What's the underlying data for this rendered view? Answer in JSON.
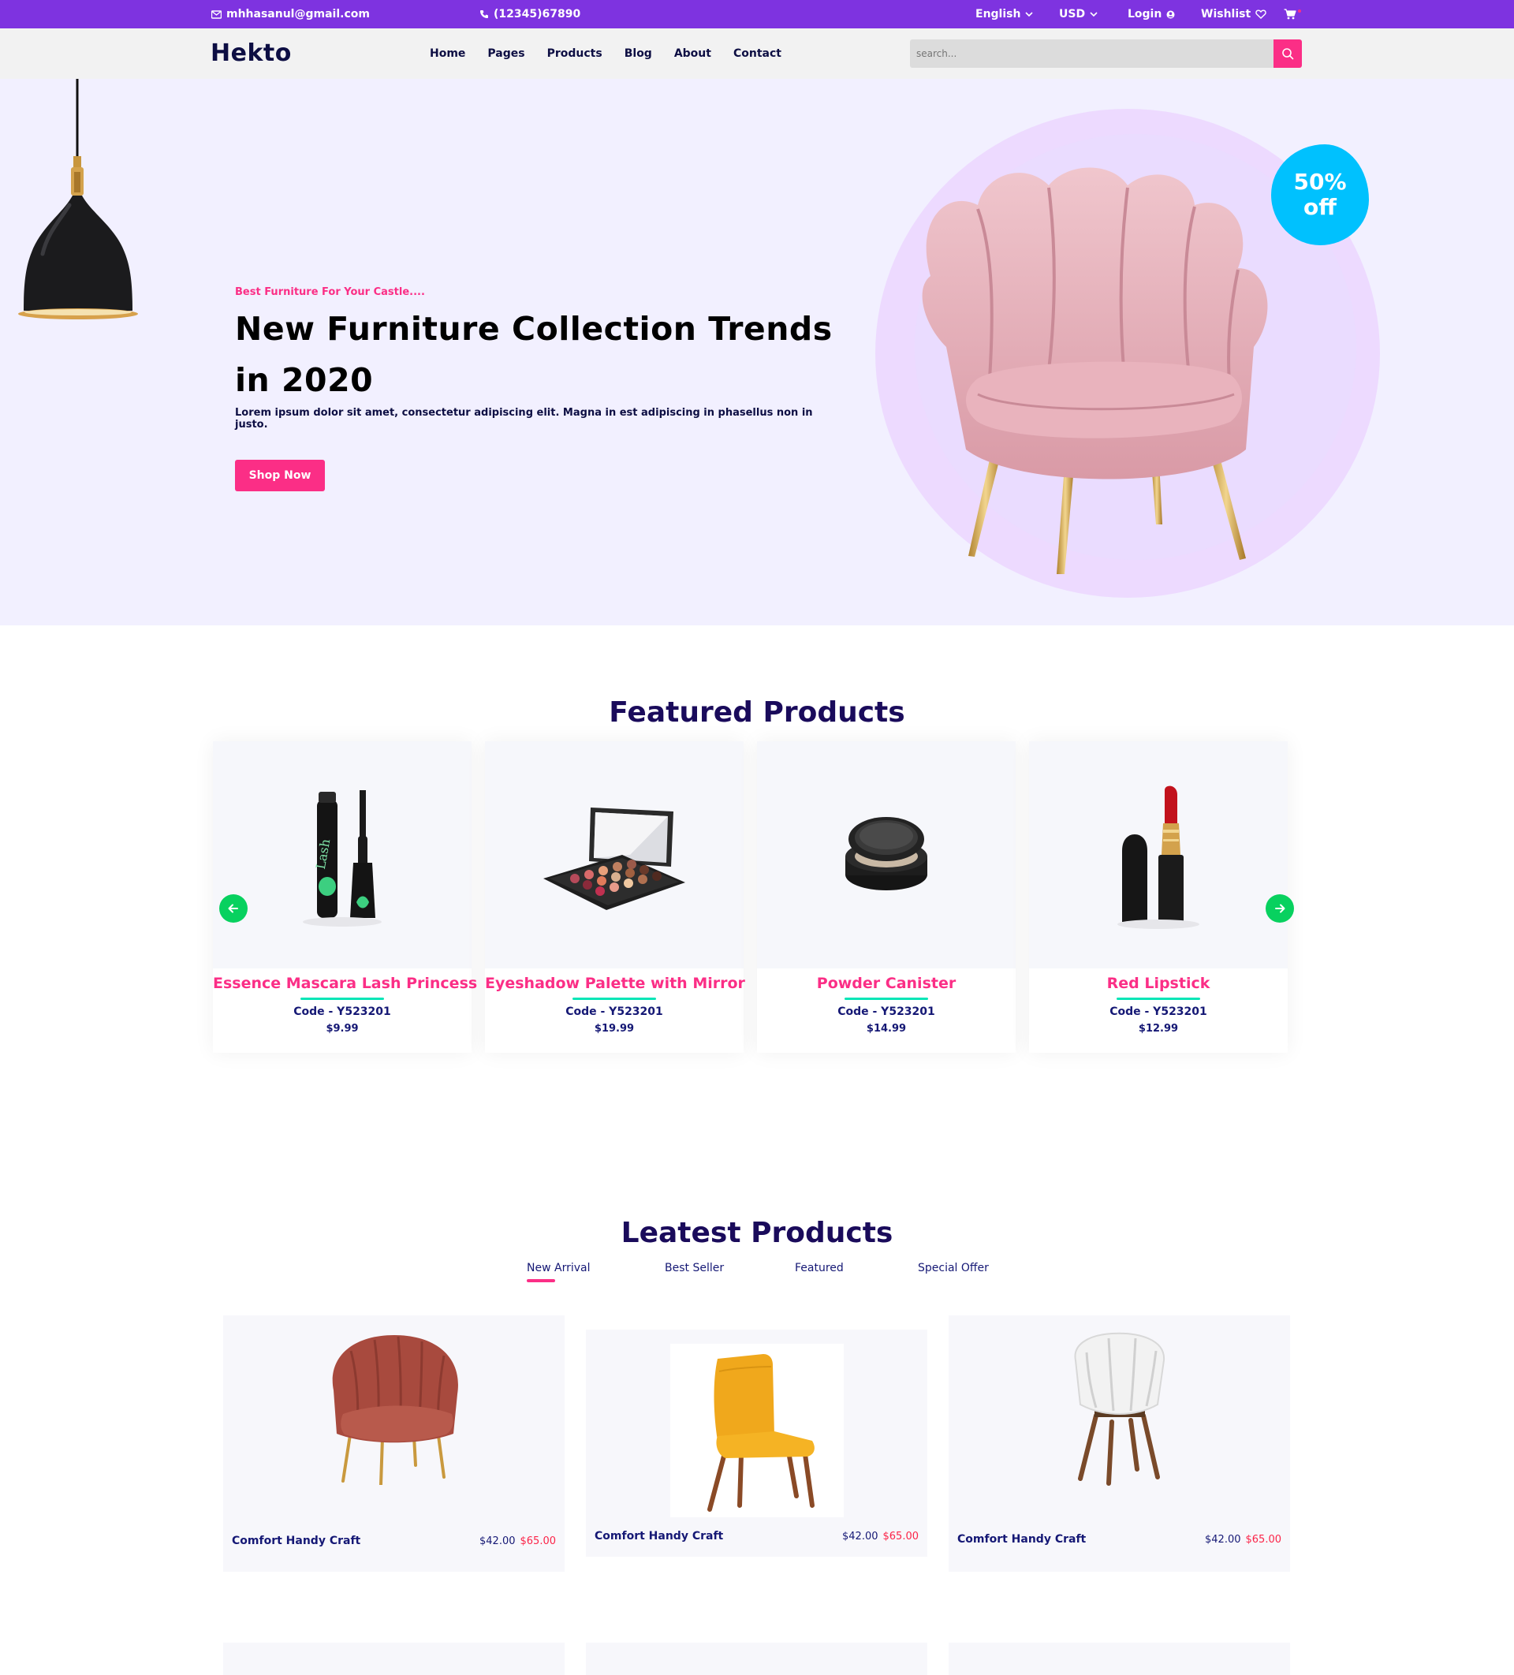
{
  "topbar": {
    "email": "mhhasanul@gmail.com",
    "phone": "(12345)67890",
    "language": "English",
    "currency": "USD",
    "login": "Login",
    "wishlist": "Wishlist"
  },
  "header": {
    "logo": "Hekto",
    "nav": [
      "Home",
      "Pages",
      "Products",
      "Blog",
      "About",
      "Contact"
    ],
    "search_placeholder": "search..."
  },
  "hero": {
    "tagline": "Best Furniture For Your Castle....",
    "title": "New Furniture Collection Trends in 2020",
    "description": "Lorem ipsum dolor sit amet, consectetur adipiscing elit. Magna in est adipiscing in phasellus non in justo.",
    "cta": "Shop Now",
    "badge_line1": "50%",
    "badge_line2": "off"
  },
  "featured": {
    "title": "Featured Products",
    "products": [
      {
        "name": "Essence Mascara Lash Princess",
        "code": "Code - Y523201",
        "price": "$9.99",
        "icon": "mascara-icon"
      },
      {
        "name": "Eyeshadow Palette with Mirror",
        "code": "Code - Y523201",
        "price": "$19.99",
        "icon": "eyeshadow-palette-icon"
      },
      {
        "name": "Powder Canister",
        "code": "Code - Y523201",
        "price": "$14.99",
        "icon": "powder-canister-icon"
      },
      {
        "name": "Red Lipstick",
        "code": "Code - Y523201",
        "price": "$12.99",
        "icon": "lipstick-icon"
      }
    ]
  },
  "latest": {
    "title": "Leatest Products",
    "tabs": [
      "New Arrival",
      "Best Seller",
      "Featured",
      "Special Offer"
    ],
    "active_tab": "New Arrival",
    "products": [
      {
        "name": "Comfort Handy Craft",
        "price": "$42.00",
        "old_price": "$65.00",
        "icon": "velvet-armchair-icon"
      },
      {
        "name": "Comfort Handy Craft",
        "price": "$42.00",
        "old_price": "$65.00",
        "icon": "yellow-chair-icon"
      },
      {
        "name": "Comfort Handy Craft",
        "price": "$42.00",
        "old_price": "$65.00",
        "icon": "white-chair-icon"
      }
    ]
  },
  "colors": {
    "topbar": "#7e33e0",
    "accent_pink": "#fb2e86",
    "navy": "#151875",
    "hero_bg": "#f2f0ff",
    "badge_blue": "#00c1fe",
    "arrow_green": "#08d15f",
    "underline_teal": "#05e6b7"
  }
}
